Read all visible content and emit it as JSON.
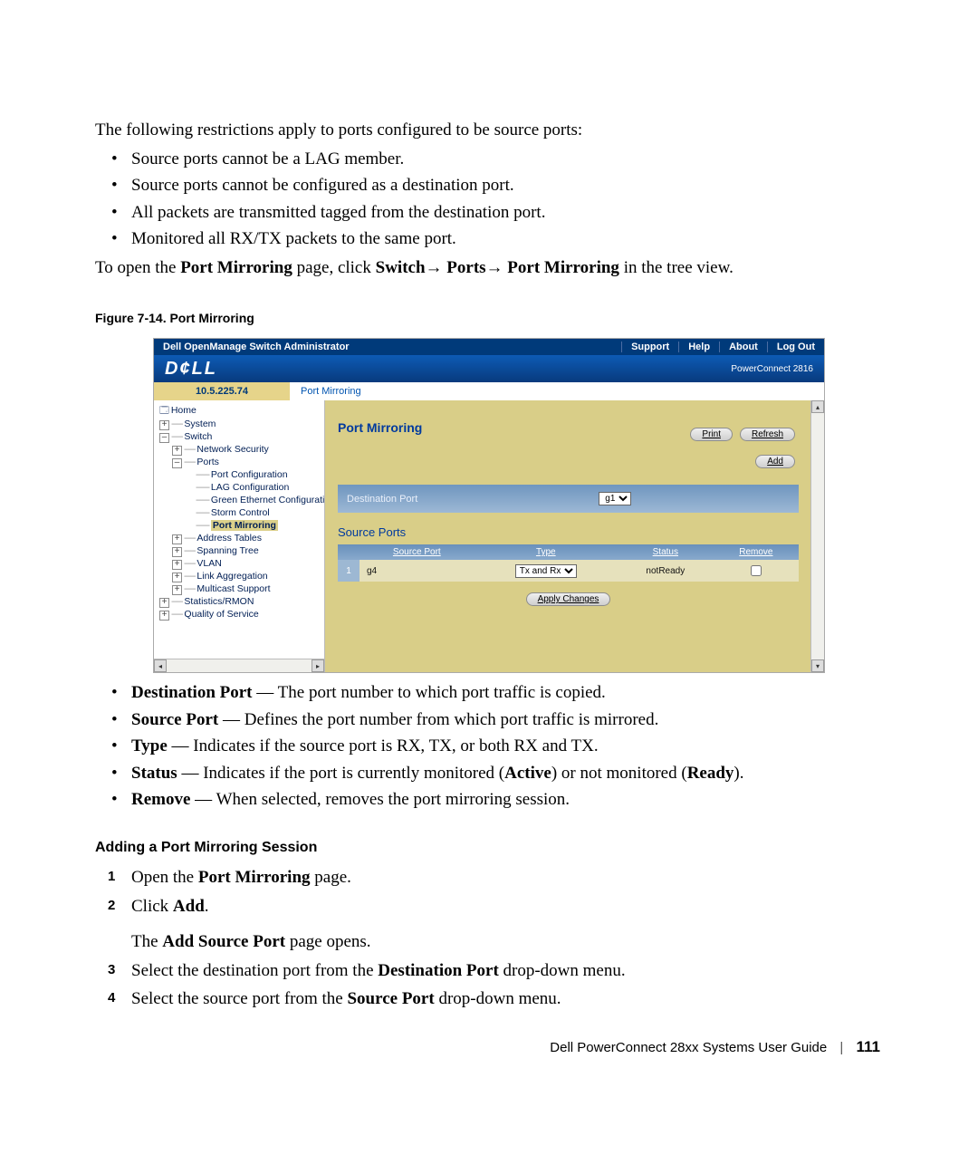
{
  "intro": "The following restrictions apply to ports configured to be source ports:",
  "bullets": [
    "Source ports cannot be a LAG member.",
    "Source ports cannot be configured as a destination port.",
    "All packets are transmitted tagged from the destination port.",
    "Monitored all RX/TX packets to the same port."
  ],
  "open_para": {
    "pre": "To open the ",
    "b1": "Port Mirroring",
    "mid1": " page, click ",
    "b2": "Switch",
    "arrow1": "→ ",
    "b3": "Ports",
    "arrow2": "→ ",
    "b4": "Port Mirroring",
    "post": " in the tree view."
  },
  "figure_caption": "Figure 7-14.    Port Mirroring",
  "screenshot": {
    "titlebar": {
      "title": "Dell OpenManage Switch Administrator",
      "nav": [
        "Support",
        "Help",
        "About",
        "Log Out"
      ]
    },
    "brand": {
      "logo": "D¢LL",
      "model": "PowerConnect 2816"
    },
    "ipbar": {
      "ip": "10.5.225.74",
      "breadcrumb": "Port Mirroring"
    },
    "tree": {
      "home": "Home",
      "system": "System",
      "switch": "Switch",
      "network_security": "Network Security",
      "ports": "Ports",
      "port_configuration": "Port Configuration",
      "lag_configuration": "LAG Configuration",
      "green_ethernet": "Green Ethernet Configurati",
      "storm_control": "Storm Control",
      "port_mirroring": "Port Mirroring",
      "address_tables": "Address Tables",
      "spanning_tree": "Spanning Tree",
      "vlan": "VLAN",
      "link_aggregation": "Link Aggregation",
      "multicast_support": "Multicast Support",
      "statistics_rmon": "Statistics/RMON",
      "quality_of_service": "Quality of Service"
    },
    "panel": {
      "title": "Port Mirroring",
      "buttons": {
        "print": "Print",
        "refresh": "Refresh",
        "add": "Add"
      },
      "dest_label": "Destination Port",
      "dest_value": "g1",
      "source_section": "Source Ports",
      "columns": {
        "source_port": "Source Port",
        "type": "Type",
        "status": "Status",
        "remove": "Remove"
      },
      "row": {
        "num": "1",
        "port": "g4",
        "type": "Tx and Rx",
        "status": "notReady"
      },
      "apply": "Apply Changes"
    }
  },
  "definitions": [
    {
      "term": "Destination Port",
      "text": " — The port number to which port traffic is copied."
    },
    {
      "term": "Source Port",
      "text": " — Defines the port number from which port traffic is mirrored."
    },
    {
      "term": "Type",
      "text": " — Indicates if the source port is RX, TX, or both RX and TX."
    },
    {
      "term": "Status",
      "text_pre": " — Indicates if the port is currently monitored (",
      "b1": "Active",
      "mid": ") or not monitored (",
      "b2": "Ready",
      "post": ")."
    },
    {
      "term": "Remove",
      "text": " — When selected, removes the port mirroring session."
    }
  ],
  "subheading": "Adding a Port Mirroring Session",
  "steps": {
    "s1": {
      "pre": "Open the ",
      "b": "Port Mirroring",
      "post": " page."
    },
    "s2": {
      "pre": "Click ",
      "b": "Add",
      "post": ".",
      "sub_pre": "The ",
      "sub_b": "Add Source Port",
      "sub_post": " page opens."
    },
    "s3": {
      "pre": "Select the destination port from the ",
      "b": "Destination Port",
      "post": " drop-down menu."
    },
    "s4": {
      "pre": "Select the source port from the ",
      "b": "Source Port",
      "post": " drop-down menu."
    }
  },
  "footer": {
    "guide": "Dell PowerConnect 28xx Systems User Guide",
    "page": "111"
  }
}
